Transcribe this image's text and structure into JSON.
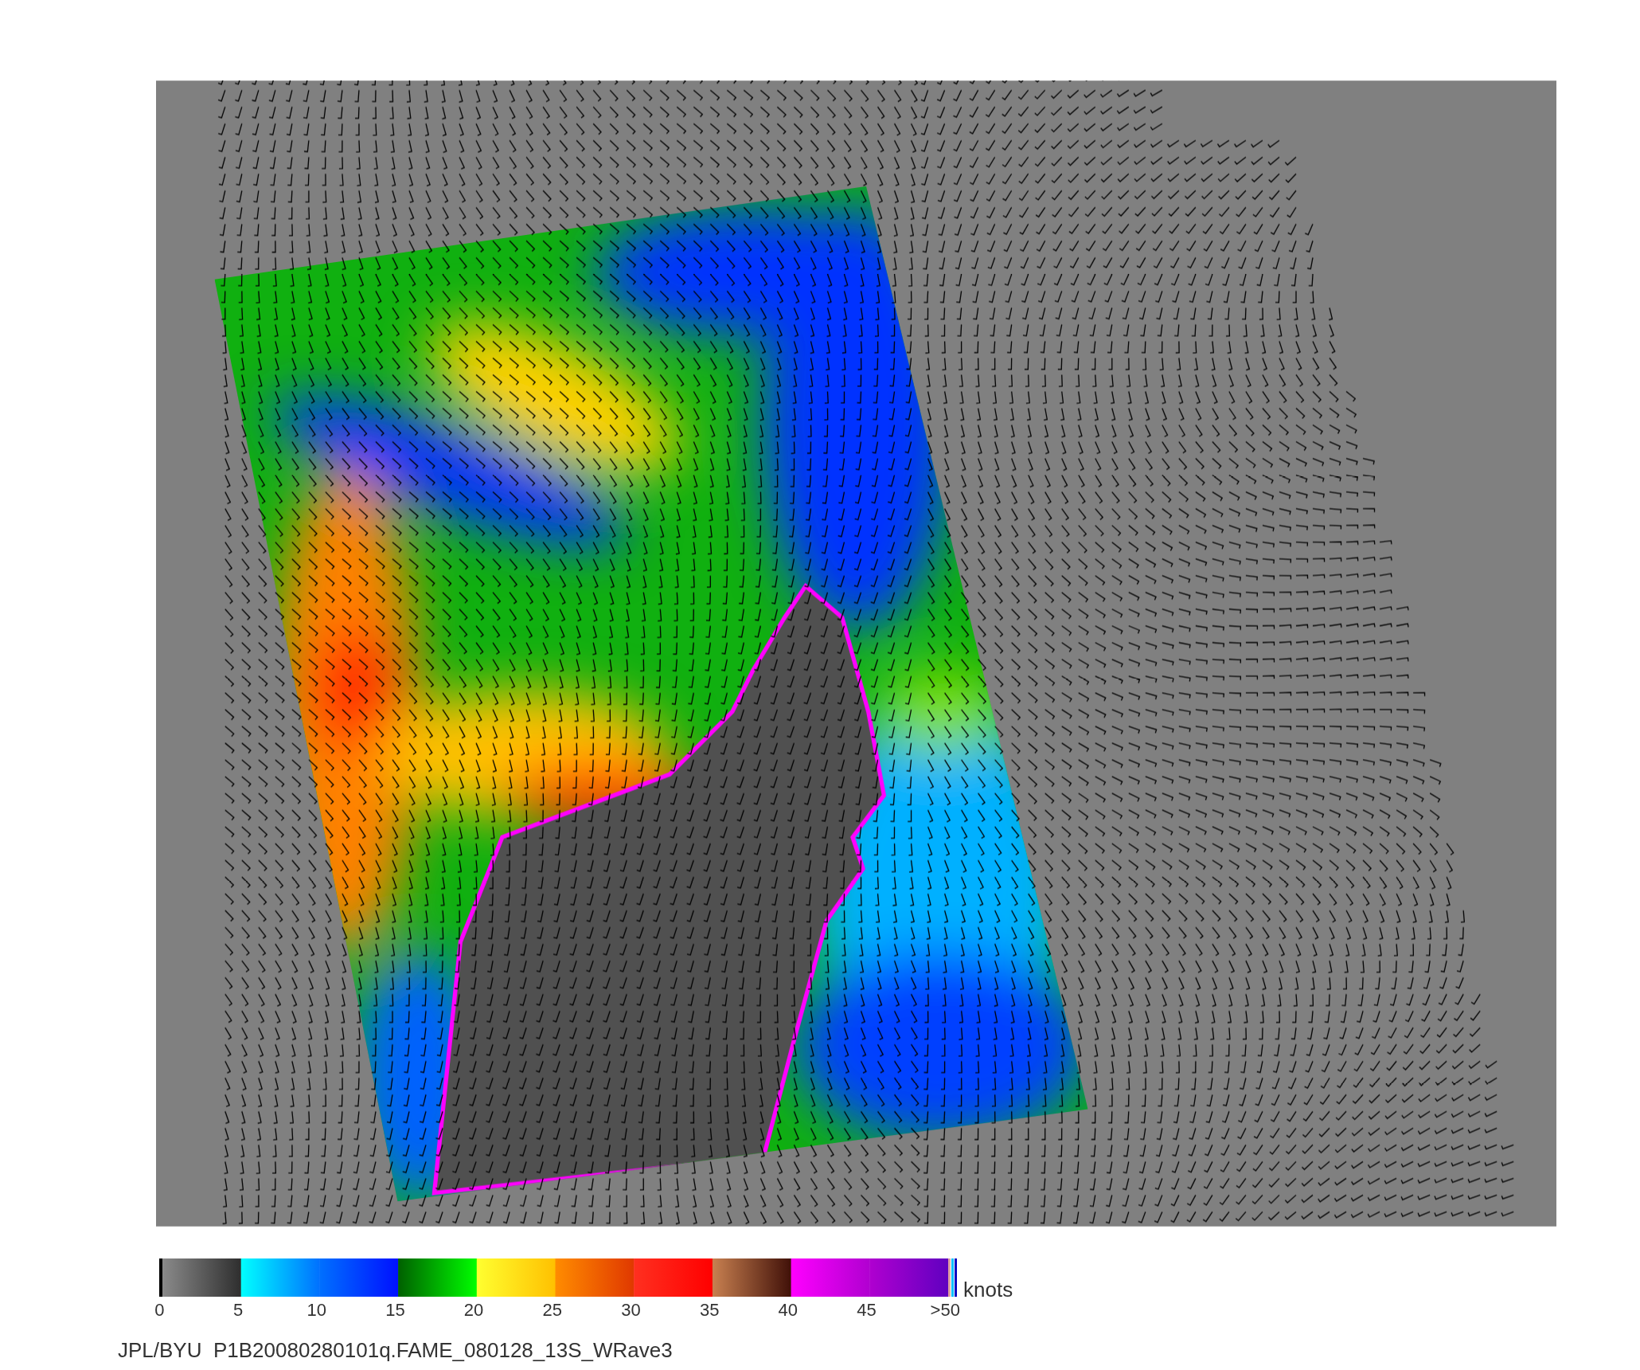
{
  "colorbar": {
    "ticks": [
      "0",
      "5",
      "10",
      "15",
      "20",
      "25",
      "30",
      "35",
      "40",
      "45",
      ">50"
    ],
    "unit": "knots"
  },
  "caption": "JPL/BYU  P1B20080280101q.FAME_080128_13S_WRave3"
}
